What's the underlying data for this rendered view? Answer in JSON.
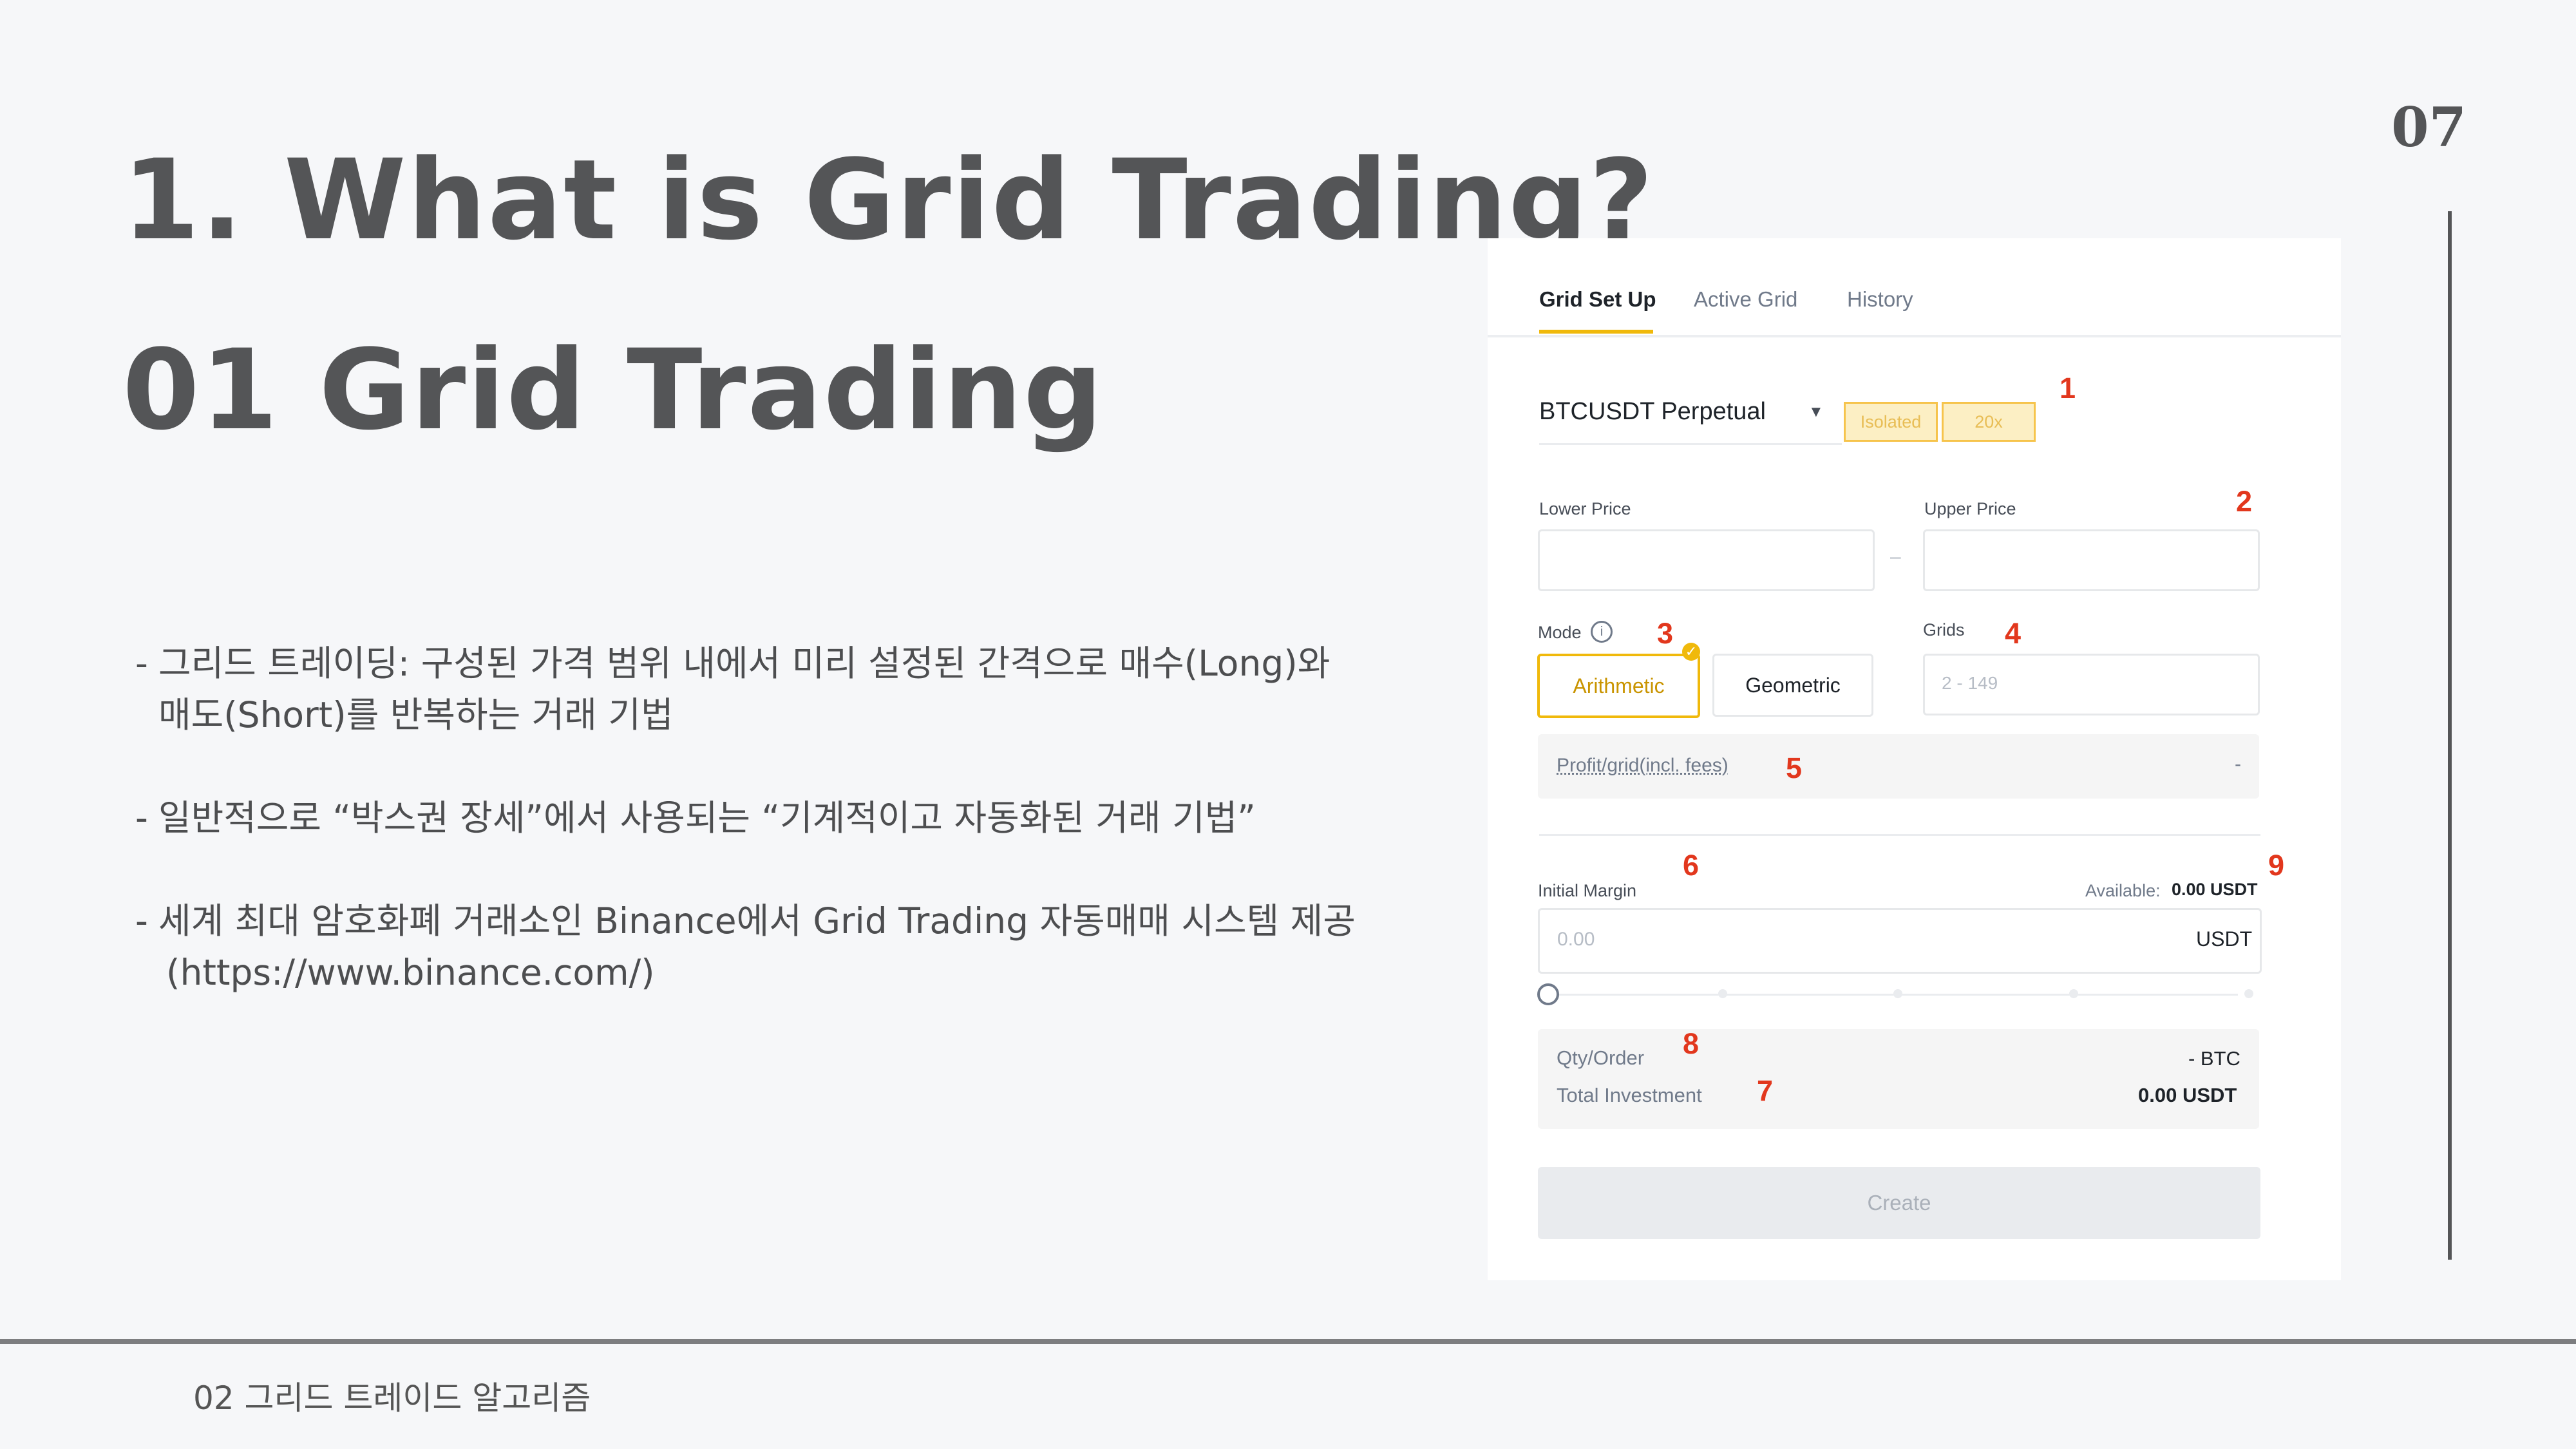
{
  "slide": {
    "title_line1": "1. What is Grid Trading?",
    "title_line2": "01 Grid Trading",
    "page_number": "07",
    "footer": "02 그리드 트레이드 알고리즘"
  },
  "bullets": [
    {
      "line1": "그리드 트레이딩: 구성된 가격 범위 내에서 미리 설정된 간격으로 매수(Long)와",
      "line2": "매도(Short)를 반복하는 거래 기법"
    },
    {
      "line1": "일반적으로 “박스권 장세”에서 사용되는 “기계적이고 자동화된 거래 기법”",
      "line2": ""
    },
    {
      "line1": "세계 최대 암호화폐 거래소인 Binance에서 Grid Trading 자동매매 시스템 제공",
      "line2": "(https://www.binance.com/)"
    }
  ],
  "panel": {
    "tabs": [
      "Grid Set Up",
      "Active Grid",
      "History"
    ],
    "symbol": "BTCUSDT Perpetual",
    "badge_isolated": "Isolated",
    "badge_leverage": "20x",
    "lower_price_label": "Lower Price",
    "upper_price_label": "Upper Price",
    "range_separator": "–",
    "mode_label": "Mode",
    "mode_arithmetic": "Arithmetic",
    "mode_geometric": "Geometric",
    "grids_label": "Grids",
    "grids_placeholder": "2 - 149",
    "profit_label": "Profit/grid(incl. fees)",
    "profit_value": "-",
    "initial_margin_label": "Initial Margin",
    "available_label": "Available:",
    "available_value": "0.00 USDT",
    "margin_placeholder": "0.00",
    "margin_unit": "USDT",
    "slider_level": 0,
    "qty_label": "Qty/Order",
    "qty_value": "- BTC",
    "total_label": "Total Investment",
    "total_value": "0.00 USDT",
    "create_label": "Create"
  },
  "annotations": [
    "1",
    "2",
    "3",
    "4",
    "5",
    "6",
    "7",
    "8",
    "9"
  ],
  "colors": {
    "accent": "#f0b90b",
    "annotation": "#e2371d",
    "title": "#545557",
    "background": "#f6f7f9"
  }
}
